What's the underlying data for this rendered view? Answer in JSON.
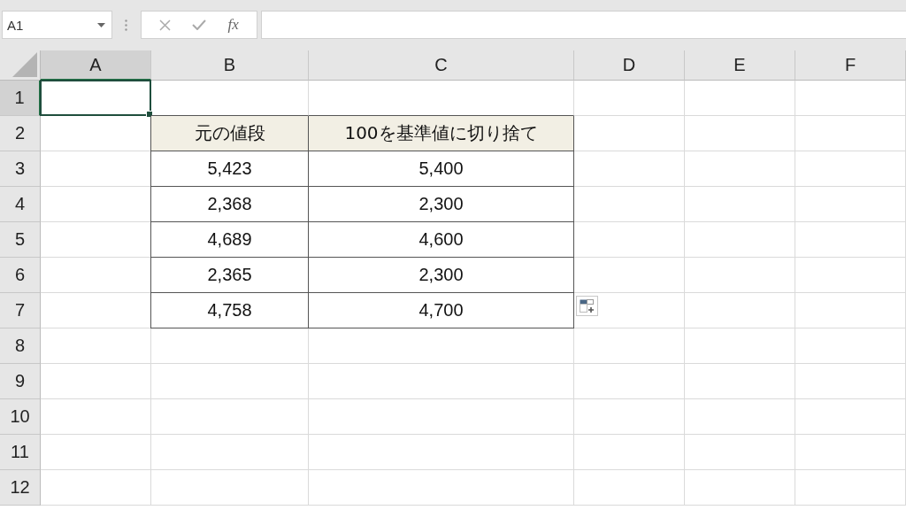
{
  "name_box": {
    "value": "A1"
  },
  "formula_bar": {
    "function_label": "fx"
  },
  "columns": [
    {
      "label": "A",
      "selected": true
    },
    {
      "label": "B",
      "selected": false
    },
    {
      "label": "C",
      "selected": false
    },
    {
      "label": "D",
      "selected": false
    },
    {
      "label": "E",
      "selected": false
    },
    {
      "label": "F",
      "selected": false
    }
  ],
  "rows": [
    {
      "label": "1",
      "selected": true
    },
    {
      "label": "2",
      "selected": false
    },
    {
      "label": "3",
      "selected": false
    },
    {
      "label": "4",
      "selected": false
    },
    {
      "label": "5",
      "selected": false
    },
    {
      "label": "6",
      "selected": false
    },
    {
      "label": "7",
      "selected": false
    },
    {
      "label": "8",
      "selected": false
    },
    {
      "label": "9",
      "selected": false
    },
    {
      "label": "10",
      "selected": false
    },
    {
      "label": "11",
      "selected": false
    },
    {
      "label": "12",
      "selected": false
    }
  ],
  "table": {
    "header": [
      "元の値段",
      "100を基準値に切り捨て"
    ],
    "rows": [
      [
        "5,423",
        "5,400"
      ],
      [
        "2,368",
        "2,300"
      ],
      [
        "4,689",
        "4,600"
      ],
      [
        "2,365",
        "2,300"
      ],
      [
        "4,758",
        "4,700"
      ]
    ]
  }
}
